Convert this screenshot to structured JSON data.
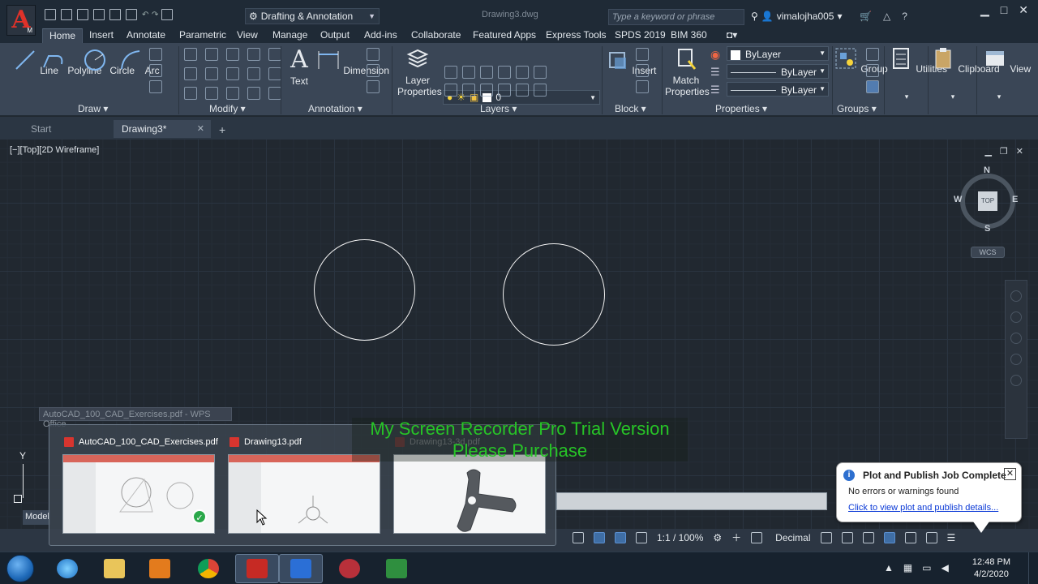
{
  "app": {
    "logo_letter": "A",
    "logo_sub": "M",
    "workspace": "Drafting & Annotation",
    "document_title": "Drawing3.dwg",
    "search_placeholder": "Type a keyword or phrase",
    "username": "vimalojha005"
  },
  "ribbon_tabs": [
    "Home",
    "Insert",
    "Annotate",
    "Parametric",
    "View",
    "Manage",
    "Output",
    "Add-ins",
    "Collaborate",
    "Featured Apps",
    "Express Tools",
    "SPDS 2019",
    "BIM 360"
  ],
  "ribbon": {
    "draw": {
      "title": "Draw",
      "tools": [
        "Line",
        "Polyline",
        "Circle",
        "Arc"
      ]
    },
    "modify": {
      "title": "Modify"
    },
    "annotation": {
      "title": "Annotation",
      "tools": [
        "Text",
        "Dimension"
      ]
    },
    "layers": {
      "title": "Layers",
      "tool_line1": "Layer",
      "tool_line2": "Properties",
      "current_layer": "0"
    },
    "block": {
      "title": "Block",
      "tool": "Insert"
    },
    "properties": {
      "title": "Properties",
      "tool_line1": "Match",
      "tool_line2": "Properties",
      "color": "ByLayer",
      "linetype": "ByLayer",
      "lineweight": "ByLayer"
    },
    "groups": {
      "title": "Groups",
      "tool": "Group"
    },
    "utilities": "Utilities",
    "clipboard": "Clipboard",
    "view": "View"
  },
  "file_tabs": {
    "start": "Start",
    "current": "Drawing3*"
  },
  "viewport": {
    "label": "[−][Top][2D Wireframe]",
    "viewcube": {
      "n": "N",
      "s": "S",
      "e": "E",
      "w": "W",
      "face": "TOP",
      "wcs": "WCS"
    },
    "ucs_y": "Y"
  },
  "taskbar_popup": {
    "hint": "AutoCAD_100_CAD_Exercises.pdf - WPS Office",
    "thumbnails": [
      {
        "title": "AutoCAD_100_CAD_Exercises.pdf"
      },
      {
        "title": "Drawing13.pdf"
      },
      {
        "title": "Drawing13-3d.pdf"
      }
    ]
  },
  "watermark": {
    "line1": "My Screen Recorder Pro Trial Version",
    "line2": "Please Purchase"
  },
  "status": {
    "model": "Model",
    "scale": "1:1 / 100%",
    "units": "Decimal"
  },
  "notification": {
    "title": "Plot and Publish Job Complete",
    "message": "No errors or warnings found",
    "link": "Click to view plot and publish details..."
  },
  "clock": {
    "time": "12:48 PM",
    "date": "4/2/2020"
  },
  "colors": {
    "accent": "#e0322a",
    "watermark": "#27c427",
    "link": "#0a39d6"
  }
}
